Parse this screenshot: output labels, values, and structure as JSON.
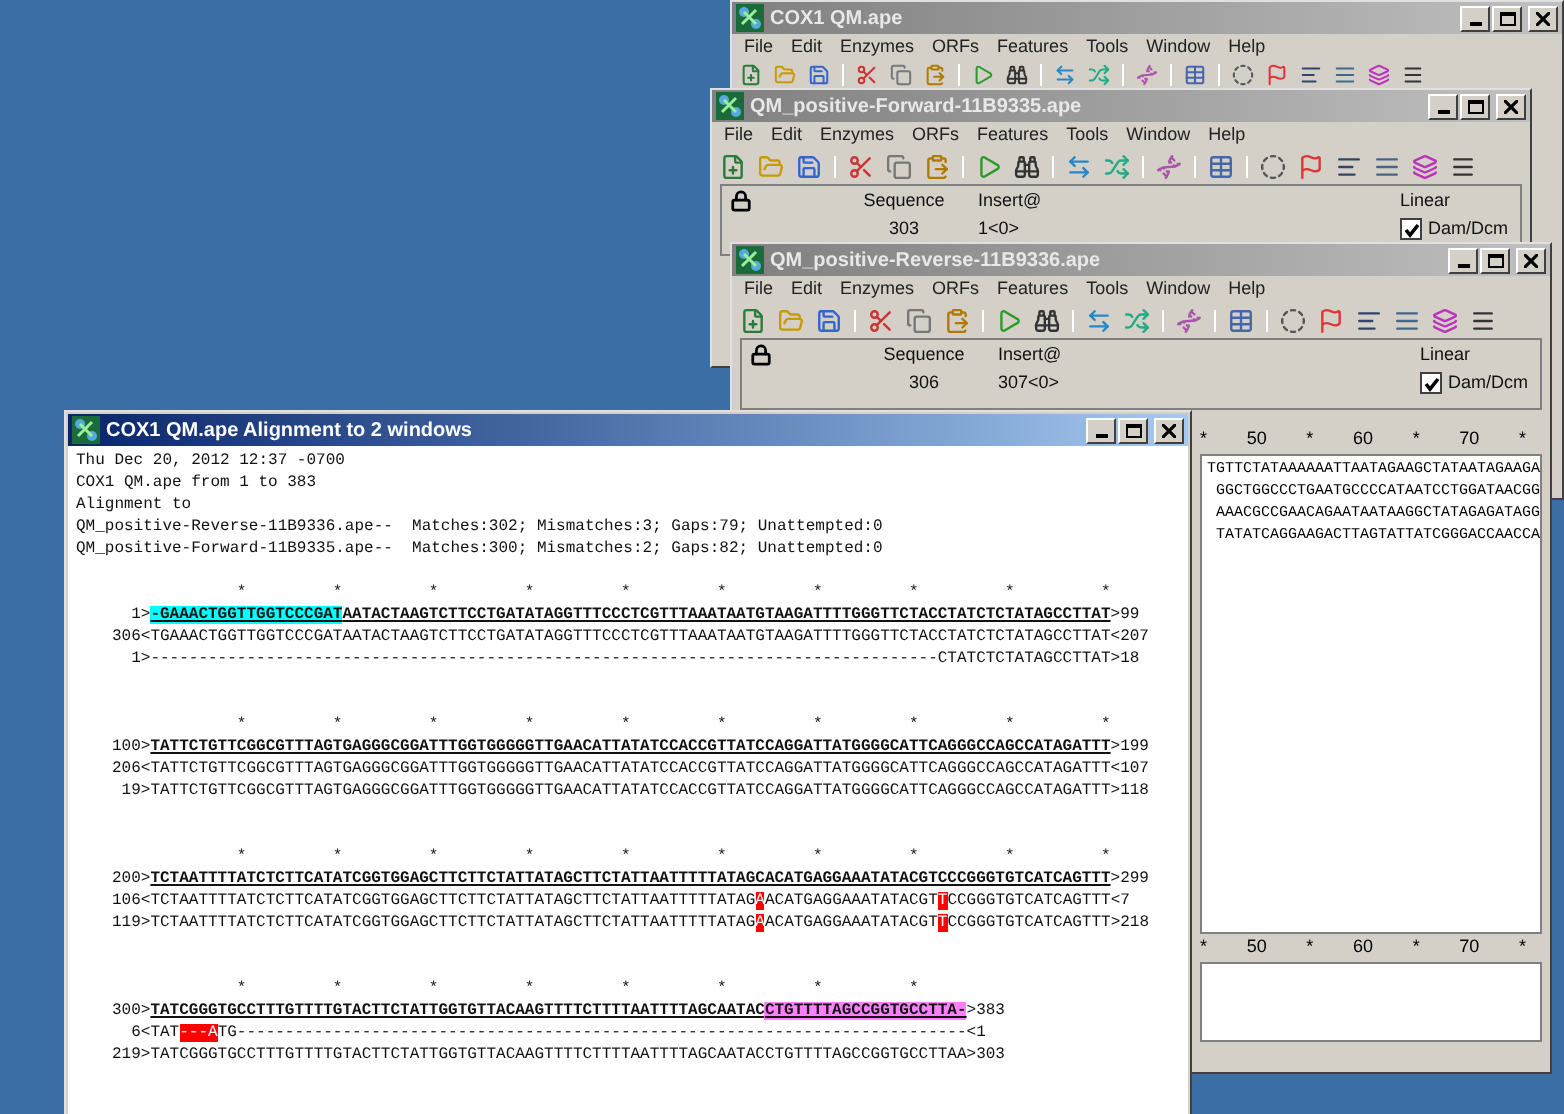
{
  "windows": [
    {
      "title": "COX1 QM.ape",
      "active": false,
      "menu": [
        "File",
        "Edit",
        "Enzymes",
        "ORFs",
        "Features",
        "Tools",
        "Window",
        "Help"
      ]
    },
    {
      "title": "QM_positive-Forward-11B9335.ape",
      "active": false,
      "menu": [
        "File",
        "Edit",
        "Enzymes",
        "ORFs",
        "Features",
        "Tools",
        "Window",
        "Help"
      ],
      "info": {
        "sequence_label": "Sequence",
        "sequence": "303",
        "insert_label": "Insert@",
        "insert": "1<0>",
        "topology": "Linear",
        "dam_dcm": {
          "label": "Dam/Dcm",
          "checked": true
        }
      }
    },
    {
      "title": "QM_positive-Reverse-11B9336.ape",
      "active": false,
      "menu": [
        "File",
        "Edit",
        "Enzymes",
        "ORFs",
        "Features",
        "Tools",
        "Window",
        "Help"
      ],
      "info": {
        "sequence_label": "Sequence",
        "sequence": "306",
        "insert_label": "Insert@",
        "insert": "307<0>",
        "topology": "Linear",
        "dam_dcm": {
          "label": "Dam/Dcm",
          "checked": true
        }
      },
      "ruler": [
        "*",
        "50",
        "*",
        "60",
        "*",
        "70",
        "*"
      ],
      "sequence_lines": [
        "TGTTCTATAAAAAATTAATAGAAGCTATAATAGAAGA",
        "GGCTGGCCCTGAATGCCCCATAATCCTGGATAACGG",
        "AAACGCCGAACAGAATAATAAGGCTATAGAGATAGG",
        "TATATCAGGAAGACTTAGTATTATCGGGACCAACCA"
      ],
      "ruler_2": [
        "*",
        "50",
        "*",
        "60",
        "*",
        "70",
        "*"
      ]
    }
  ],
  "alignment_window": {
    "title": "COX1 QM.ape Alignment to 2 windows",
    "active": true,
    "header": [
      "Thu Dec 20, 2012 12:37 -0700",
      "COX1 QM.ape from 1 to 383",
      "Alignment to",
      "QM_positive-Reverse-11B9336.ape--  Matches:302; Mismatches:3; Gaps:79; Unattempted:0",
      "QM_positive-Forward-11B9335.ape--  Matches:300; Mismatches:2; Gaps:82; Unattempted:0"
    ],
    "blocks": [
      {
        "stars": "             *         *         *         *         *         *         *         *         *         *",
        "lines": [
          {
            "kind": "reference",
            "segments": [
              {
                "kind": "label",
                "text": "  1>"
              },
              {
                "kind": "primer_start",
                "text": "-GAAACTGGTTGGTCCCGAT"
              },
              {
                "kind": "seq",
                "text": "AATACTAAGTCTTCCTGATATAGGTTTCCCTCGTTTAAATAATGTAAGATTTTGGGTTCTACCTATCTCTATAGCCTTAT"
              },
              {
                "kind": "label",
                "text": ">99"
              }
            ]
          },
          {
            "kind": "read",
            "segments": [
              {
                "kind": "label",
                "text": "306<"
              },
              {
                "kind": "seq",
                "text": "TGAAACTGGTTGGTCCCGATAATACTAAGTCTTCCTGATATAGGTTTCCCTCGTTTAAATAATGTAAGATTTTGGGTTCTACCTATCTCTATAGCCTTAT"
              },
              {
                "kind": "label",
                "text": "<207"
              }
            ]
          },
          {
            "kind": "read",
            "segments": [
              {
                "kind": "label",
                "text": "  1>"
              },
              {
                "kind": "seq",
                "text": "----------------------------------------------------------------------------------CTATCTCTATAGCCTTAT"
              },
              {
                "kind": "label",
                "text": ">18"
              }
            ]
          }
        ]
      },
      {
        "stars": "             *         *         *         *         *         *         *         *         *         *",
        "lines": [
          {
            "kind": "reference",
            "segments": [
              {
                "kind": "label",
                "text": "100>"
              },
              {
                "kind": "seq",
                "text": "TATTCTGTTCGGCGTTTAGTGAGGGCGGATTTGGTGGGGGTTGAACATTATATCCACCGTTATCCAGGATTATGGGGCATTCAGGGCCAGCCATAGATTT"
              },
              {
                "kind": "label",
                "text": ">199"
              }
            ]
          },
          {
            "kind": "read",
            "segments": [
              {
                "kind": "label",
                "text": "206<"
              },
              {
                "kind": "seq",
                "text": "TATTCTGTTCGGCGTTTAGTGAGGGCGGATTTGGTGGGGGTTGAACATTATATCCACCGTTATCCAGGATTATGGGGCATTCAGGGCCAGCCATAGATTT"
              },
              {
                "kind": "label",
                "text": "<107"
              }
            ]
          },
          {
            "kind": "read",
            "segments": [
              {
                "kind": "label",
                "text": " 19>"
              },
              {
                "kind": "seq",
                "text": "TATTCTGTTCGGCGTTTAGTGAGGGCGGATTTGGTGGGGGTTGAACATTATATCCACCGTTATCCAGGATTATGGGGCATTCAGGGCCAGCCATAGATTT"
              },
              {
                "kind": "label",
                "text": ">118"
              }
            ]
          }
        ]
      },
      {
        "stars": "             *         *         *         *         *         *         *         *         *         *",
        "lines": [
          {
            "kind": "reference",
            "segments": [
              {
                "kind": "label",
                "text": "200>"
              },
              {
                "kind": "seq",
                "text": "TCTAATTTTATCTCTTCATATCGGTGGAGCTTCTTCTATTATAGCTTCTATTAATTTTTATAGCACATGAGGAAATATACGTCCCGGGTGTCATCAGTTT"
              },
              {
                "kind": "label",
                "text": ">299"
              }
            ]
          },
          {
            "kind": "read",
            "segments": [
              {
                "kind": "label",
                "text": "106<"
              },
              {
                "kind": "seq",
                "text": "TCTAATTTTATCTCTTCATATCGGTGGAGCTTCTTCTATTATAGCTTCTATTAATTTTTATAG"
              },
              {
                "kind": "mismatch",
                "text": "A"
              },
              {
                "kind": "seq",
                "text": "ACATGAGGAAATATACGT"
              },
              {
                "kind": "mismatch",
                "text": "T"
              },
              {
                "kind": "seq",
                "text": "CCGGGTGTCATCAGTTT"
              },
              {
                "kind": "label",
                "text": "<7"
              }
            ]
          },
          {
            "kind": "read",
            "segments": [
              {
                "kind": "label",
                "text": "119>"
              },
              {
                "kind": "seq",
                "text": "TCTAATTTTATCTCTTCATATCGGTGGAGCTTCTTCTATTATAGCTTCTATTAATTTTTATAG"
              },
              {
                "kind": "mismatch",
                "text": "A"
              },
              {
                "kind": "seq",
                "text": "ACATGAGGAAATATACGT"
              },
              {
                "kind": "mismatch",
                "text": "T"
              },
              {
                "kind": "seq",
                "text": "CCGGGTGTCATCAGTTT"
              },
              {
                "kind": "label",
                "text": ">218"
              }
            ]
          }
        ]
      },
      {
        "stars": "             *         *         *         *         *         *         *         *",
        "lines": [
          {
            "kind": "reference",
            "segments": [
              {
                "kind": "label",
                "text": "300>"
              },
              {
                "kind": "seq",
                "text": "TATCGGGTGCCTTTGTTTTGTACTTCTATTGGTGTTACAAGTTTTCTTTTAATTTTAGCAATAC"
              },
              {
                "kind": "primer_end",
                "text": "CTGTTTTAGCCGGTGCCTTA-"
              },
              {
                "kind": "label",
                "text": ">383"
              }
            ]
          },
          {
            "kind": "read",
            "segments": [
              {
                "kind": "label",
                "text": "  6<"
              },
              {
                "kind": "seq",
                "text": "TAT"
              },
              {
                "kind": "mismatch",
                "text": "---A"
              },
              {
                "kind": "seq",
                "text": "TG----------------------------------------------------------------------------"
              },
              {
                "kind": "label",
                "text": "<1"
              }
            ]
          },
          {
            "kind": "read",
            "segments": [
              {
                "kind": "label",
                "text": "219>"
              },
              {
                "kind": "seq",
                "text": "TATCGGGTGCCTTTGTTTTGTACTTCTATTGGTGTTACAAGTTTTCTTTTAATTTTAGCAATACCTGTTTTAGCCGGTGCCTTAA"
              },
              {
                "kind": "label",
                "text": ">303"
              }
            ]
          }
        ]
      }
    ]
  }
}
